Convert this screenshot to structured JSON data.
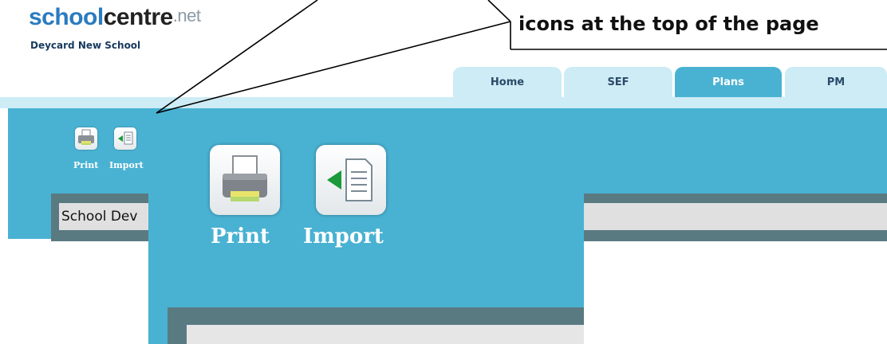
{
  "brand": {
    "logo_school": "school",
    "logo_centre": "centre",
    "logo_net": ".net",
    "school_name": "Deycard New School"
  },
  "callout": {
    "text": "icons at the top of the page"
  },
  "tabs": [
    {
      "label": "Home",
      "active": false
    },
    {
      "label": "SEF",
      "active": false
    },
    {
      "label": "Plans",
      "active": true
    },
    {
      "label": "PM",
      "active": false
    }
  ],
  "toolbar": {
    "print_label": "Print",
    "import_label": "Import"
  },
  "document": {
    "title_partial": "School Dev"
  },
  "zoom": {
    "print_label": "Print",
    "import_label": "Import"
  },
  "colors": {
    "main_blue": "#49b2d2",
    "tab_inactive": "#cdecf5",
    "dark_panel": "#5a7a82",
    "logo_blue": "#2b7bbf"
  }
}
